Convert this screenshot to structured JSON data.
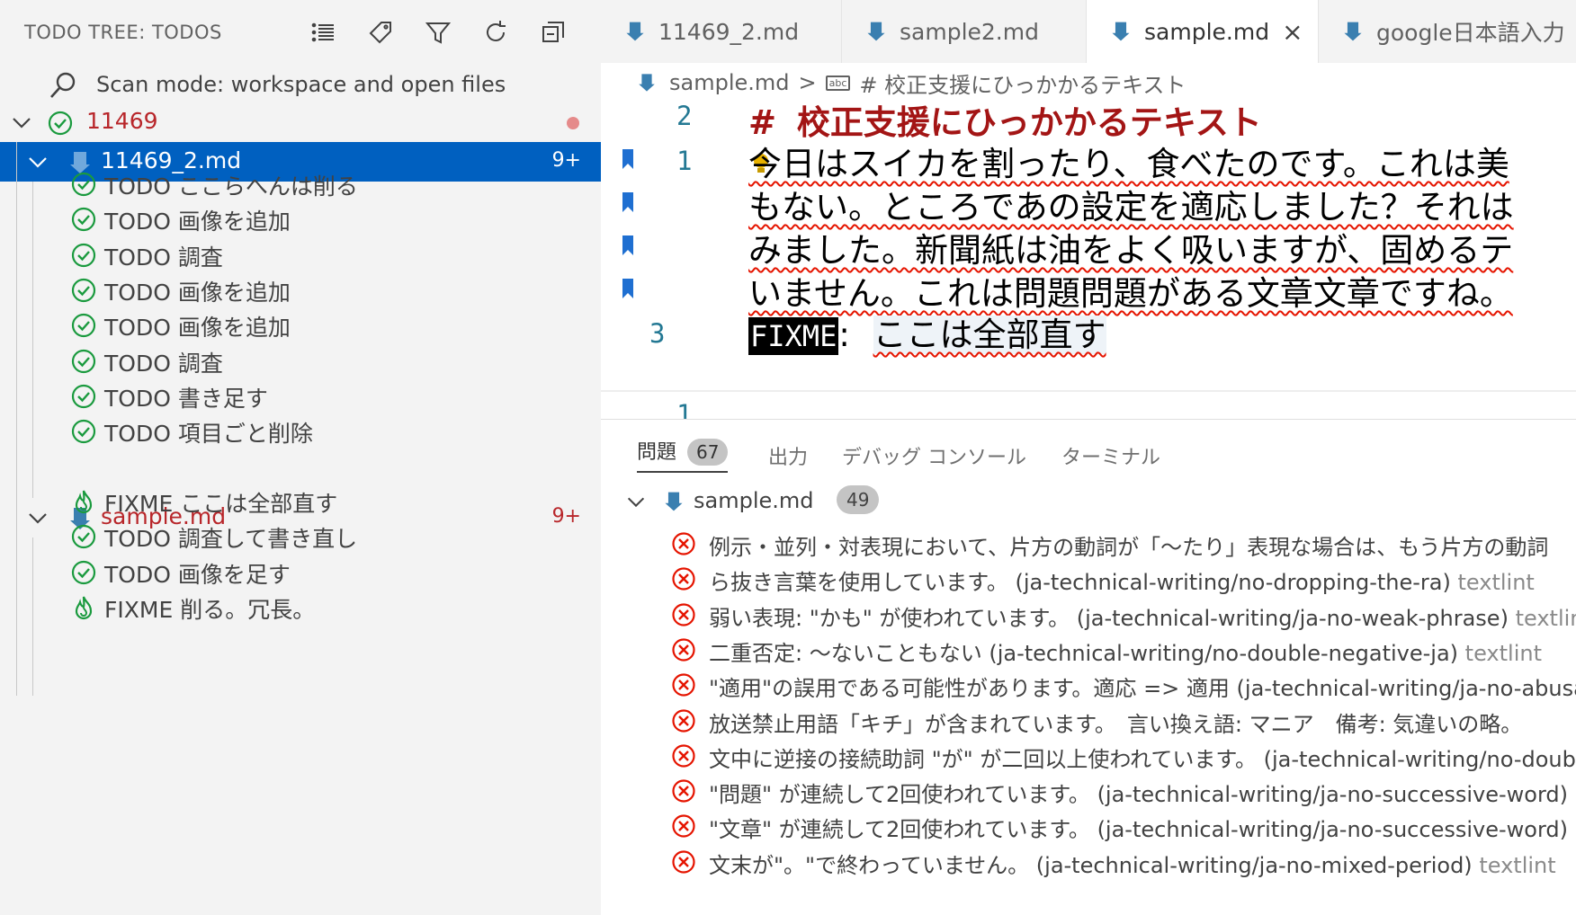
{
  "sidebar": {
    "title": "TODO TREE: TODOS",
    "actions": [
      "list-icon",
      "tag-icon",
      "filter-icon",
      "refresh-icon",
      "collapse-all-icon"
    ],
    "scan_mode": "Scan mode: workspace and open files",
    "root_folder": {
      "label": "11469"
    },
    "files": [
      {
        "label": "11469_2.md",
        "badge": "9+",
        "items": [
          {
            "text": "TODO ここらへんは削る",
            "kind": "todo"
          },
          {
            "text": "TODO 画像を追加",
            "kind": "todo"
          },
          {
            "text": "TODO 調査",
            "kind": "todo"
          },
          {
            "text": "TODO 画像を追加",
            "kind": "todo"
          },
          {
            "text": "TODO 画像を追加",
            "kind": "todo"
          },
          {
            "text": "TODO 調査",
            "kind": "todo"
          },
          {
            "text": "TODO 書き足す",
            "kind": "todo"
          },
          {
            "text": "TODO 項目ごと削除",
            "kind": "todo"
          }
        ]
      },
      {
        "label": "sample.md",
        "badge": "9+",
        "items": [
          {
            "text": "FIXME ここは全部直す",
            "kind": "fixme"
          },
          {
            "text": "TODO 調査して書き直し",
            "kind": "todo"
          },
          {
            "text": "TODO 画像を足す",
            "kind": "todo"
          },
          {
            "text": "FIXME 削る。冗長。",
            "kind": "fixme"
          }
        ]
      }
    ]
  },
  "tabs": [
    {
      "label": "11469_2.md",
      "active": false
    },
    {
      "label": "sample2.md",
      "active": false
    },
    {
      "label": "sample.md",
      "active": true,
      "close": "×"
    },
    {
      "label": "google日本語入力",
      "active": false
    }
  ],
  "breadcrumb": {
    "file": "sample.md",
    "sep": ">",
    "section": "# 校正支援にひっかかるテキスト",
    "symbol": "abc"
  },
  "editor": {
    "heading_lnum": "2",
    "heading_hash": "#",
    "heading_text": "校正支援にひっかかるテキスト",
    "para_lnum": "1",
    "para_lines": [
      "今日はスイカを割ったり、食べたのです。これは美",
      "もない。ところであの設定を適応しました？それは",
      "みました。新聞紙は油をよく吸いますが、固めるテ",
      "いません。これは問題問題がある文章文章ですね。"
    ],
    "fixme_lnum": "3",
    "fixme_tag": "FIXME",
    "fixme_colon": ":",
    "fixme_text": "ここは全部直す",
    "next_lnum": "1"
  },
  "panel": {
    "tabs": [
      {
        "label": "問題",
        "badge": "67",
        "active": true
      },
      {
        "label": "出力"
      },
      {
        "label": "デバッグ コンソール"
      },
      {
        "label": "ターミナル"
      }
    ],
    "file": {
      "name": "sample.md",
      "count": "49"
    },
    "problems": [
      {
        "msg": "例示・並列・対表現において、片方の動詞が「〜たり」表現な場合は、もう片方の動詞",
        "src": ""
      },
      {
        "msg": "ら抜き言葉を使用しています。 (ja-technical-writing/no-dropping-the-ra)",
        "src": "textlint"
      },
      {
        "msg": "弱い表現: \"かも\" が使われています。 (ja-technical-writing/ja-no-weak-phrase)",
        "src": "textlint"
      },
      {
        "msg": "二重否定: 〜ないこともない (ja-technical-writing/no-double-negative-ja)",
        "src": "textlint"
      },
      {
        "msg": "\"適用\"の誤用である可能性があります。適応 => 適用 (ja-technical-writing/ja-no-abusage)",
        "src": ""
      },
      {
        "msg": "放送禁止用語「キチ」が含まれています。　言い換え語: マニア　備考: 気違いの略。",
        "src": ""
      },
      {
        "msg": "文中に逆接の接続助詞 \"が\" が二回以上使われています。 (ja-technical-writing/no-doubled-conjunctive-particle-ga)",
        "src": ""
      },
      {
        "msg": "\"問題\" が連続して2回使われています。 (ja-technical-writing/ja-no-successive-word)",
        "src": ""
      },
      {
        "msg": "\"文章\" が連続して2回使われています。 (ja-technical-writing/ja-no-successive-word)",
        "src": ""
      },
      {
        "msg": "文末が\"。\"で終わっていません。 (ja-technical-writing/ja-no-mixed-period)",
        "src": "textlint"
      }
    ]
  },
  "colors": {
    "selection": "#0060c0",
    "todo_icon": "#1a9a3e",
    "error": "#e51400",
    "file_icon": "#3a7fb0"
  }
}
